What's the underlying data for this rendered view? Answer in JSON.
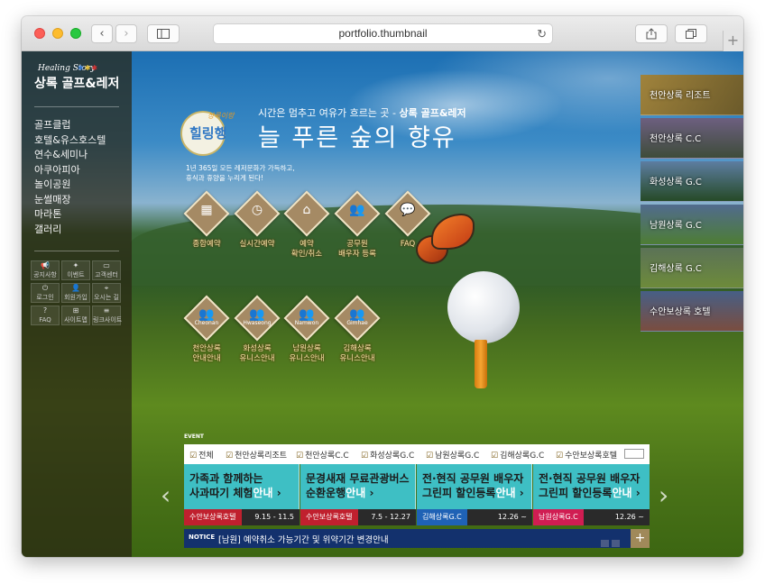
{
  "browser": {
    "url": "portfolio.thumbnail",
    "back_icon": "‹",
    "forward_icon": "›",
    "reload_icon": "↻"
  },
  "logo": {
    "small": "Healing Story",
    "name": "상록 골프&레저"
  },
  "sidebar": {
    "nav": [
      "골프클럽",
      "호텔&유스호스텔",
      "연수&세미나",
      "아쿠아피아",
      "놀이공원",
      "눈썰매장",
      "마라톤",
      "갤러리"
    ],
    "quick": [
      {
        "icon": "📢",
        "label": "공지사항"
      },
      {
        "icon": "✦",
        "label": "이벤트"
      },
      {
        "icon": "▭",
        "label": "고객센터"
      },
      {
        "icon": "⏻",
        "label": "로그인"
      },
      {
        "icon": "👤",
        "label": "회원가입"
      },
      {
        "icon": "⌖",
        "label": "오시는 길"
      },
      {
        "icon": "?",
        "label": "FAQ"
      },
      {
        "icon": "⊞",
        "label": "사이트맵"
      },
      {
        "icon": "≡",
        "label": "링크사이트"
      }
    ]
  },
  "hero": {
    "badge_sub": "상록이랑",
    "badge": "힐링행",
    "tagline": "시간은 멈추고 여유가 흐르는 곳 - ",
    "tagline_bold": "상록 골프&레저",
    "title": "늘 푸른 숲의 향유",
    "desc_line1": "1년 365일 모든 레저문화가 가득하고,",
    "desc_line2": "휴식과 휴양을 누리게 된다!"
  },
  "services": [
    {
      "icon": "▦",
      "label": "종합예약"
    },
    {
      "icon": "◷",
      "label": "실시간예약"
    },
    {
      "icon": "⌂",
      "label": "예약\n확인/취소"
    },
    {
      "icon": "👥",
      "label": "공무원\n배우자 등록"
    },
    {
      "icon": "💬",
      "label": "FAQ"
    }
  ],
  "courses": [
    {
      "en": "Cheonan",
      "label": "천안상록\n안내안내"
    },
    {
      "en": "Hwaseong",
      "label": "화성상록\n유니스안내"
    },
    {
      "en": "Namwon",
      "label": "남원상록\n유니스안내"
    },
    {
      "en": "Gimhae",
      "label": "김해상록\n유니스안내"
    }
  ],
  "right_nav": [
    "천안상록 리조트",
    "천안상록 C.C",
    "화성상록 G.C",
    "남원상록 G.C",
    "김해상록 G.C",
    "수안보상록 호텔"
  ],
  "event": {
    "heading": "EVENT",
    "filters": [
      "전체",
      "천안상록리조트",
      "천안상록C.C",
      "화성상록G.C",
      "남원상록G.C",
      "김해상록G.C",
      "수안보상록호텔"
    ],
    "check": "☑",
    "cards": [
      {
        "line1": "가족과 함께하는",
        "line2": "사과따기 체험",
        "more": "안내",
        "tag": "수안보상록호텔",
        "date": "9.15 - 11.5",
        "tag_color": "#c0202e"
      },
      {
        "line1": "문경새재 무료관광버스",
        "line2": "순환운행",
        "more": "안내",
        "tag": "수안보상록호텔",
        "date": "7.5 - 12.27",
        "tag_color": "#c0202e"
      },
      {
        "line1": "전·현직 공무원 배우자",
        "line2": "그린피 할인등록",
        "more": "안내",
        "tag": "김해상록G.C",
        "date": "12.26 ~",
        "tag_color": "#1f62b5"
      },
      {
        "line1": "전·현직 공무원 배우자",
        "line2": "그린피 할인등록",
        "more": "안내",
        "tag": "남원상록G.C",
        "date": "12.26 ~",
        "tag_color": "#d01d52"
      }
    ],
    "prev": "‹",
    "next": "›"
  },
  "notice": {
    "label": "NOTICE",
    "text": "[남원] 예약취소 가능기간 및 위약기간 변경안내",
    "plus": "+"
  }
}
